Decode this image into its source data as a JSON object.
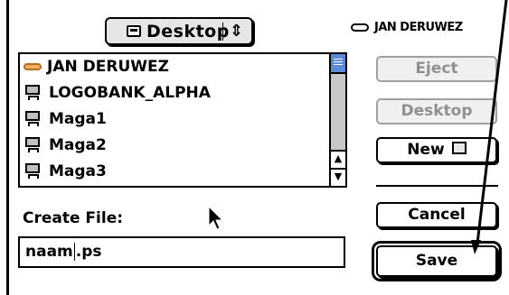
{
  "location_popup": {
    "label": "Desktop",
    "icon": "desktop-icon",
    "arrows": "up-down-arrows-icon"
  },
  "volume": {
    "name": "JAN DERUWEZ",
    "icon": "drive-icon"
  },
  "file_list": {
    "items": [
      {
        "name": "JAN DERUWEZ",
        "icon": "disk-icon"
      },
      {
        "name": "LOGOBANK_ALPHA",
        "icon": "server-icon"
      },
      {
        "name": "Maga1",
        "icon": "server-icon"
      },
      {
        "name": "Maga2",
        "icon": "server-icon"
      },
      {
        "name": "Maga3",
        "icon": "server-icon"
      }
    ]
  },
  "create_file": {
    "label": "Create File:",
    "value_before_caret": "naam",
    "value_after_caret": ".ps"
  },
  "buttons": {
    "eject": "Eject",
    "desktop": "Desktop",
    "new": "New",
    "cancel": "Cancel",
    "save": "Save"
  },
  "colors": {
    "scroll_thumb": "#5a8ad8",
    "disk_icon": "#f4b060"
  }
}
